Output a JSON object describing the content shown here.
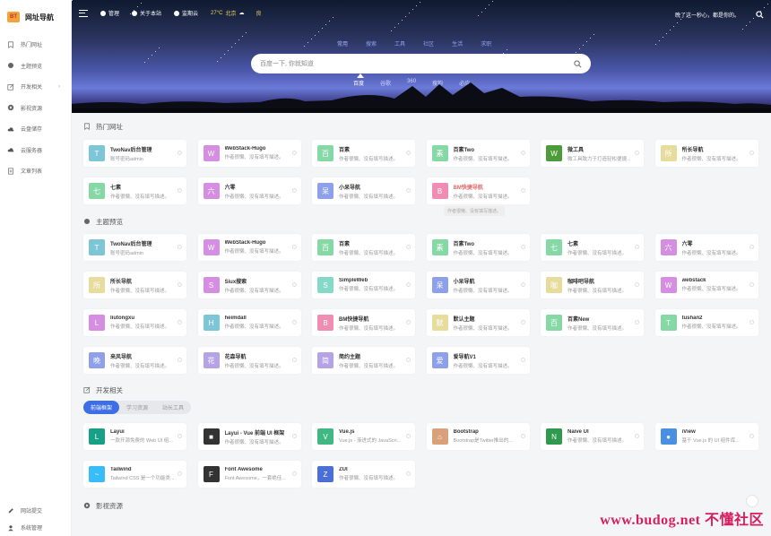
{
  "brand": {
    "mark": "BT",
    "name": "网址导航"
  },
  "sidebar": {
    "items": [
      {
        "label": "热门网址",
        "icon": "bookmark-icon"
      },
      {
        "label": "主题预览",
        "icon": "palette-icon"
      },
      {
        "label": "开发相关",
        "icon": "edit-icon",
        "chevron": "›"
      },
      {
        "label": "影视资源",
        "icon": "play-icon"
      },
      {
        "label": "云盘储存",
        "icon": "cloud-icon"
      },
      {
        "label": "云服务器",
        "icon": "cloud-icon"
      },
      {
        "label": "文章列表",
        "icon": "document-icon"
      }
    ],
    "bottom": [
      {
        "label": "网站提交",
        "icon": "pencil-icon"
      },
      {
        "label": "系统管理",
        "icon": "user-icon"
      }
    ]
  },
  "topbar": {
    "links": [
      {
        "label": "管理"
      },
      {
        "label": "关于本站"
      },
      {
        "label": "监期云"
      }
    ],
    "weather": {
      "temp": "27°C",
      "city": "北京",
      "condition": "良"
    },
    "slogan": "晚了这一秒心，都是你的。"
  },
  "search": {
    "categories": [
      "常用",
      "搜索",
      "工具",
      "社区",
      "生活",
      "求职"
    ],
    "placeholder": "百度一下, 你就知道",
    "engines": [
      "百度",
      "谷歌",
      "360",
      "搜狗",
      "必应"
    ]
  },
  "sections": {
    "hot": {
      "title": "热门网址",
      "cards": [
        {
          "name": "TwoNav后台管理",
          "desc": "账号密码admin",
          "tile": "T",
          "color": "#7dc6d8"
        },
        {
          "name": "WebStack-Hugo",
          "desc": "作者很懒、没有填写描述。",
          "tile": "W",
          "color": "#d58ee2"
        },
        {
          "name": "百素",
          "desc": "作者很懒、没有填写描述。",
          "tile": "百",
          "color": "#86d9a5"
        },
        {
          "name": "百素Two",
          "desc": "作者很懒、没有填写描述。",
          "tile": "素",
          "color": "#86d9a5"
        },
        {
          "name": "微工具",
          "desc": "微工具致力于打造轻松便捷...",
          "tile": "W",
          "color": "#4d9c3a"
        },
        {
          "name": "所长导航",
          "desc": "作者很懒、没有填写描述。",
          "tile": "所",
          "color": "#e6dc9c"
        },
        {
          "name": "七素",
          "desc": "作者很懒、没有填写描述。",
          "tile": "七",
          "color": "#86d9a5"
        },
        {
          "name": "六零",
          "desc": "作者很懒、没有填写描述。",
          "tile": "六",
          "color": "#d58ee2"
        },
        {
          "name": "小呆导航",
          "desc": "作者很懒、没有填写描述。",
          "tile": "呆",
          "color": "#8ea0ea"
        },
        {
          "name": "BM快捷导航",
          "desc": "作者很懒、没有填写描述。",
          "tile": "B",
          "color": "#ef8db4",
          "highlight": "#e06a6a"
        }
      ],
      "tooltip": "作者很懒、没有填写描述。"
    },
    "themes": {
      "title": "主题预览",
      "cards": [
        {
          "name": "TwoNav后台管理",
          "desc": "账号密码admin",
          "tile": "T",
          "color": "#7dc6d8"
        },
        {
          "name": "WebStack-Hugo",
          "desc": "作者很懒、没有填写描述。",
          "tile": "W",
          "color": "#d58ee2"
        },
        {
          "name": "百素",
          "desc": "作者很懒、没有填写描述。",
          "tile": "百",
          "color": "#86d9a5"
        },
        {
          "name": "百素Two",
          "desc": "作者很懒、没有填写描述。",
          "tile": "素",
          "color": "#86d9a5"
        },
        {
          "name": "七素",
          "desc": "作者很懒、没有填写描述。",
          "tile": "七",
          "color": "#86d9a5"
        },
        {
          "name": "六零",
          "desc": "作者很懒、没有填写描述。",
          "tile": "六",
          "color": "#d58ee2"
        },
        {
          "name": "所长导航",
          "desc": "作者很懒、没有填写描述。",
          "tile": "所",
          "color": "#e6dc9c"
        },
        {
          "name": "Siux搜索",
          "desc": "作者很懒、没有填写描述。",
          "tile": "S",
          "color": "#d58ee2"
        },
        {
          "name": "SimpleWeb",
          "desc": "作者很懒、没有填写描述。",
          "tile": "S",
          "color": "#86d9c8"
        },
        {
          "name": "小呆导航",
          "desc": "作者很懒、没有填写描述。",
          "tile": "呆",
          "color": "#8ea0ea"
        },
        {
          "name": "咖啡吧导航",
          "desc": "作者很懒、没有填写描述。",
          "tile": "咖",
          "color": "#e6dc9c"
        },
        {
          "name": "webstack",
          "desc": "作者很懒、没有填写描述。",
          "tile": "W",
          "color": "#d58ee2"
        },
        {
          "name": "liutongxu",
          "desc": "作者很懒、没有填写描述。",
          "tile": "L",
          "color": "#d58ee2"
        },
        {
          "name": "heimdall",
          "desc": "作者很懒、没有填写描述。",
          "tile": "H",
          "color": "#7dc6d8"
        },
        {
          "name": "BM快捷导航",
          "desc": "作者很懒、没有填写描述。",
          "tile": "B",
          "color": "#ef8db4"
        },
        {
          "name": "默认主题",
          "desc": "作者很懒、没有填写描述。",
          "tile": "默",
          "color": "#e6dc9c"
        },
        {
          "name": "百素New",
          "desc": "作者很懒、没有填写描述。",
          "tile": "百",
          "color": "#86d9a5"
        },
        {
          "name": "tushan2",
          "desc": "作者很懒、没有填写描述。",
          "tile": "T",
          "color": "#86d9a5"
        },
        {
          "name": "来风导航",
          "desc": "作者很懒、没有填写描述。",
          "tile": "晚",
          "color": "#8ea0ea"
        },
        {
          "name": "花森导航",
          "desc": "作者很懒、没有填写描述。",
          "tile": "花",
          "color": "#b5a3e6"
        },
        {
          "name": "简约主题",
          "desc": "作者很懒、没有填写描述。",
          "tile": "简",
          "color": "#b5a3e6"
        },
        {
          "name": "爱导航V1",
          "desc": "作者很懒、没有填写描述。",
          "tile": "爱",
          "color": "#8ea0ea"
        }
      ]
    },
    "dev": {
      "title": "开发相关",
      "chips": [
        "前端框架",
        "学习资源",
        "站长工具"
      ],
      "cards": [
        {
          "name": "Layui",
          "desc": "一款开源免费的 Web UI 组...",
          "tile": "L",
          "color": "#16a085"
        },
        {
          "name": "Layui - Vue 前端 UI 框架",
          "desc": "作者很懒、没有填写描述。",
          "tile": "■",
          "color": "#333333"
        },
        {
          "name": "Vue.js",
          "desc": "Vue.js - 渐进式的 JavaScri...",
          "tile": "V",
          "color": "#41b883"
        },
        {
          "name": "Bootstrap",
          "desc": "Bootstrap是Twitter推出的...",
          "tile": "⌂",
          "color": "#d9a17a"
        },
        {
          "name": "Naive UI",
          "desc": "作者很懒、没有填写描述。",
          "tile": "N",
          "color": "#2f9a4d"
        },
        {
          "name": "iView",
          "desc": "基于 Vue.js 的 UI 组件库...",
          "tile": "●",
          "color": "#4a90e2"
        },
        {
          "name": "Tailwind",
          "desc": "Tailwind CSS 是一个功能类...",
          "tile": "~",
          "color": "#38bdf8"
        },
        {
          "name": "Font Awesome",
          "desc": "Font Awesome，一套绝佳...",
          "tile": "F",
          "color": "#333333"
        },
        {
          "name": "ZUI",
          "desc": "作者很懒、没有填写描述。",
          "tile": "Z",
          "color": "#4a6fd8"
        }
      ]
    },
    "media": {
      "title": "影视资源"
    }
  },
  "watermark": "www.budog.net 不懂社区"
}
